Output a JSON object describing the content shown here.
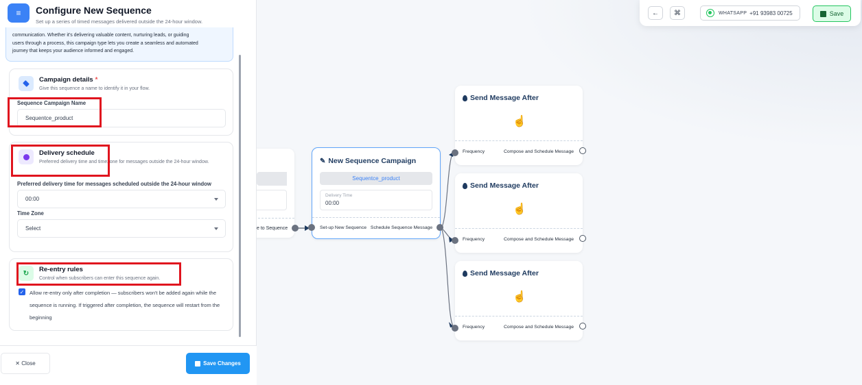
{
  "panel": {
    "title": "Configure New Sequence",
    "subtitle": "Set up a series of timed messages delivered outside the 24-hour window.",
    "info_lines": [
      "communication. Whether it's delivering valuable content, nurturing leads, or guiding",
      "users through a process, this campaign type lets you create a seamless and automated",
      "journey that keeps your audience informed and engaged."
    ],
    "campaign": {
      "title": "Campaign details",
      "required_mark": "*",
      "subtitle": "Give this sequence a name to identify it in your flow.",
      "field_label": "Sequence Campaign Name",
      "field_value": "Sequentce_product"
    },
    "delivery": {
      "title": "Delivery schedule",
      "subtitle": "Preferred delivery time and timezone for messages outside the 24-hour window.",
      "time_label": "Preferred delivery time for messages scheduled outside the 24-hour window",
      "time_value": "00:00",
      "tz_label": "Time Zone",
      "tz_value": "Select"
    },
    "reentry": {
      "title": "Re-entry rules",
      "subtitle": "Control when subscribers can enter this sequence again.",
      "checkbox_checked": true,
      "checkbox_label": "Allow re-entry only after completion — subscribers won't be added again while the sequence is running. If triggered after completion, the sequence will restart from the beginning"
    },
    "footer": {
      "close_label": "✕ Close",
      "save_label": "Save Changes"
    }
  },
  "toolbar": {
    "back_icon": "arrow-left-icon",
    "layout_icon": "layout-icon",
    "whatsapp_label": "WHATSAPP",
    "whatsapp_number": "+91 93983 00725",
    "save_label": "Save"
  },
  "flow": {
    "left_node_footer": "e to Sequence",
    "main_node": {
      "title": "New Sequence Campaign",
      "campaign_value": "Sequentce_product",
      "delivery_label": "Delivery Time",
      "delivery_value": "00:00",
      "footer_left": "Set-up New Sequence",
      "footer_right": "Schedule Sequence Message"
    },
    "send_nodes": [
      {
        "title": "Send Message After",
        "footer_left": "Frequency",
        "footer_right": "Compose and Schedule Message"
      },
      {
        "title": "Send Message After",
        "footer_left": "Frequency",
        "footer_right": "Compose and Schedule Message"
      },
      {
        "title": "Send Message After",
        "footer_left": "Frequency",
        "footer_right": "Compose and Schedule Message"
      }
    ]
  },
  "colors": {
    "accent": "#3b82f6",
    "highlight": "#e0141e",
    "save_green": "#22c55e",
    "node_border": "#60a5fa"
  }
}
